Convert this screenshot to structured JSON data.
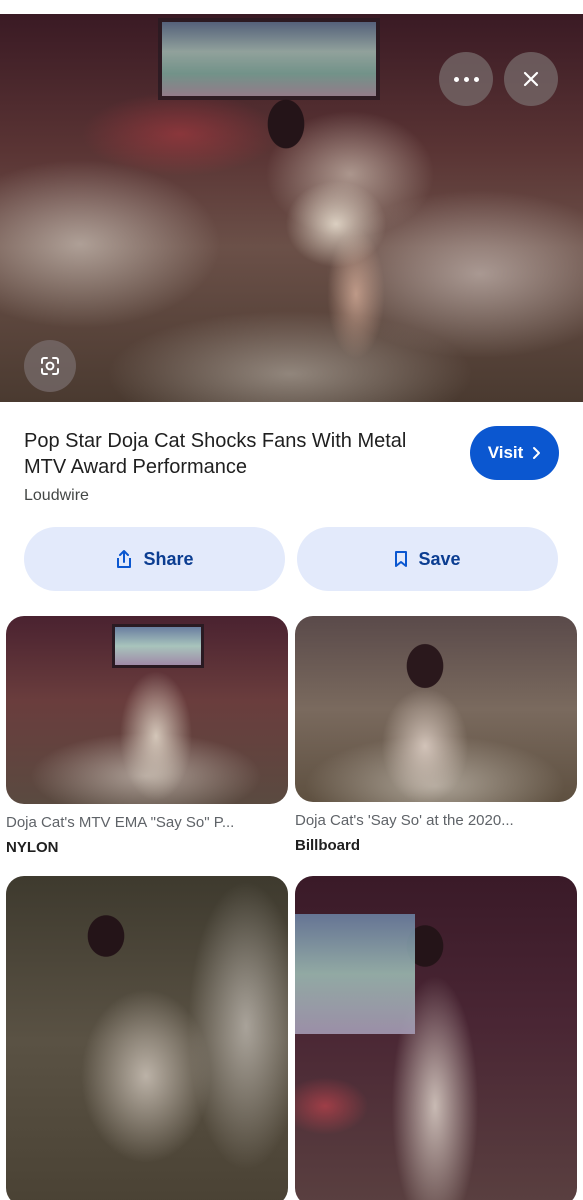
{
  "hero": {
    "more_icon": "more-horizontal-icon",
    "close_icon": "close-icon",
    "lens_icon": "lens-search-icon"
  },
  "result": {
    "title": "Pop Star Doja Cat Shocks Fans With Metal MTV Award Performance",
    "source": "Loudwire",
    "visit_label": "Visit",
    "share_label": "Share",
    "save_label": "Save"
  },
  "related": [
    {
      "caption": "Doja Cat's MTV EMA \"Say So\" P...",
      "source": "NYLON"
    },
    {
      "caption": "Doja Cat's 'Say So' at the 2020...",
      "source": "Billboard"
    }
  ],
  "colors": {
    "accent": "#0b57d0",
    "pill_bg": "#e3eafb"
  }
}
